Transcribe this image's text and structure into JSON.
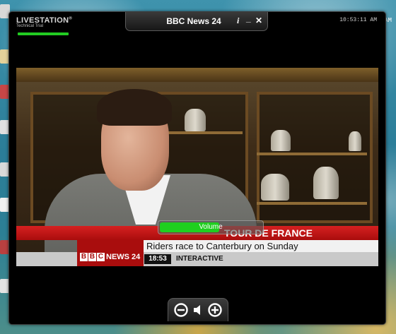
{
  "app": {
    "brand": "LIVESTATION",
    "brand_mark": "®",
    "subtitle": "Technical Trial",
    "title": "BBC News 24",
    "clock": "10:53:11 AM"
  },
  "titlebar": {
    "info_label": "i",
    "minimize_label": "_",
    "close_label": "✕"
  },
  "video": {
    "headline": "TOUR DE FRANCE",
    "subline": "Riders race to Canterbury on Sunday",
    "channel_logo": [
      "B",
      "B",
      "C"
    ],
    "channel_name": "NEWS 24",
    "time": "18:53",
    "interactive_label": "INTERACTIVE"
  },
  "volume": {
    "label": "Volume",
    "level": 0.58
  },
  "controls": {
    "volume_down": "volume-down",
    "speaker": "speaker",
    "volume_up": "volume-up"
  },
  "colors": {
    "accent_green": "#22cc22",
    "bbc_red": "#a90d0d"
  }
}
